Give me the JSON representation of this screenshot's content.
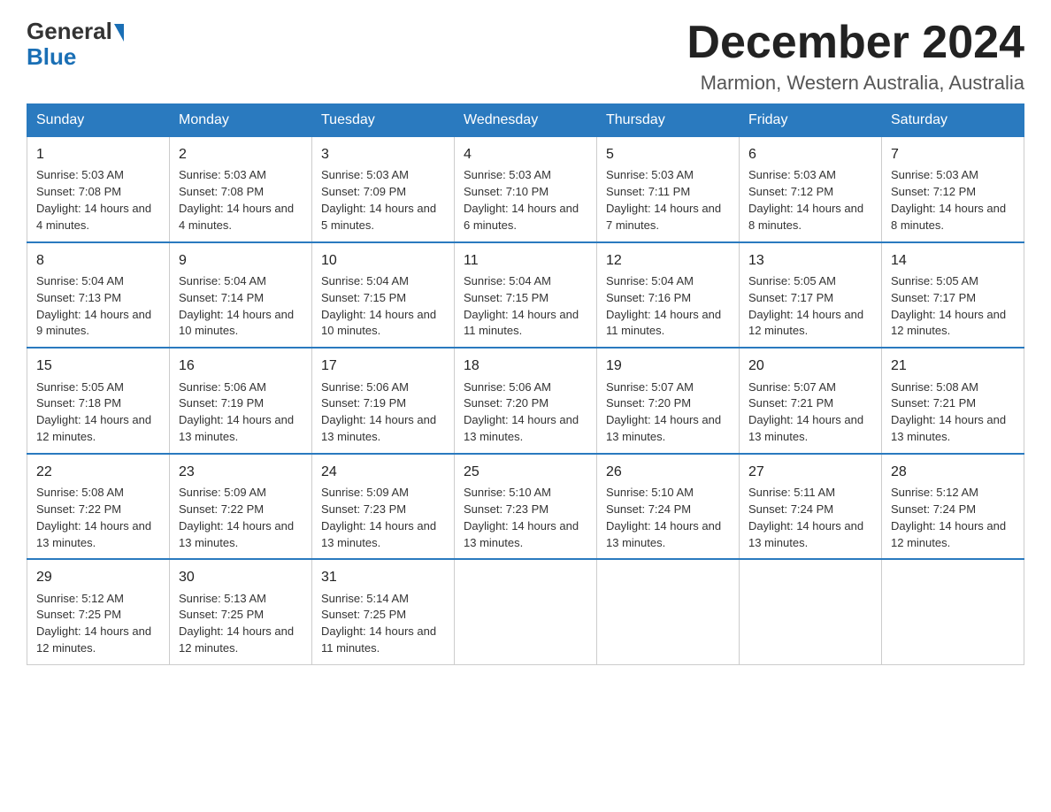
{
  "logo": {
    "text_general": "General",
    "text_blue": "Blue",
    "aria": "GeneralBlue logo"
  },
  "header": {
    "month": "December 2024",
    "location": "Marmion, Western Australia, Australia"
  },
  "days_of_week": [
    "Sunday",
    "Monday",
    "Tuesday",
    "Wednesday",
    "Thursday",
    "Friday",
    "Saturday"
  ],
  "weeks": [
    [
      {
        "day": "1",
        "sunrise": "5:03 AM",
        "sunset": "7:08 PM",
        "daylight": "14 hours and 4 minutes."
      },
      {
        "day": "2",
        "sunrise": "5:03 AM",
        "sunset": "7:08 PM",
        "daylight": "14 hours and 4 minutes."
      },
      {
        "day": "3",
        "sunrise": "5:03 AM",
        "sunset": "7:09 PM",
        "daylight": "14 hours and 5 minutes."
      },
      {
        "day": "4",
        "sunrise": "5:03 AM",
        "sunset": "7:10 PM",
        "daylight": "14 hours and 6 minutes."
      },
      {
        "day": "5",
        "sunrise": "5:03 AM",
        "sunset": "7:11 PM",
        "daylight": "14 hours and 7 minutes."
      },
      {
        "day": "6",
        "sunrise": "5:03 AM",
        "sunset": "7:12 PM",
        "daylight": "14 hours and 8 minutes."
      },
      {
        "day": "7",
        "sunrise": "5:03 AM",
        "sunset": "7:12 PM",
        "daylight": "14 hours and 8 minutes."
      }
    ],
    [
      {
        "day": "8",
        "sunrise": "5:04 AM",
        "sunset": "7:13 PM",
        "daylight": "14 hours and 9 minutes."
      },
      {
        "day": "9",
        "sunrise": "5:04 AM",
        "sunset": "7:14 PM",
        "daylight": "14 hours and 10 minutes."
      },
      {
        "day": "10",
        "sunrise": "5:04 AM",
        "sunset": "7:15 PM",
        "daylight": "14 hours and 10 minutes."
      },
      {
        "day": "11",
        "sunrise": "5:04 AM",
        "sunset": "7:15 PM",
        "daylight": "14 hours and 11 minutes."
      },
      {
        "day": "12",
        "sunrise": "5:04 AM",
        "sunset": "7:16 PM",
        "daylight": "14 hours and 11 minutes."
      },
      {
        "day": "13",
        "sunrise": "5:05 AM",
        "sunset": "7:17 PM",
        "daylight": "14 hours and 12 minutes."
      },
      {
        "day": "14",
        "sunrise": "5:05 AM",
        "sunset": "7:17 PM",
        "daylight": "14 hours and 12 minutes."
      }
    ],
    [
      {
        "day": "15",
        "sunrise": "5:05 AM",
        "sunset": "7:18 PM",
        "daylight": "14 hours and 12 minutes."
      },
      {
        "day": "16",
        "sunrise": "5:06 AM",
        "sunset": "7:19 PM",
        "daylight": "14 hours and 13 minutes."
      },
      {
        "day": "17",
        "sunrise": "5:06 AM",
        "sunset": "7:19 PM",
        "daylight": "14 hours and 13 minutes."
      },
      {
        "day": "18",
        "sunrise": "5:06 AM",
        "sunset": "7:20 PM",
        "daylight": "14 hours and 13 minutes."
      },
      {
        "day": "19",
        "sunrise": "5:07 AM",
        "sunset": "7:20 PM",
        "daylight": "14 hours and 13 minutes."
      },
      {
        "day": "20",
        "sunrise": "5:07 AM",
        "sunset": "7:21 PM",
        "daylight": "14 hours and 13 minutes."
      },
      {
        "day": "21",
        "sunrise": "5:08 AM",
        "sunset": "7:21 PM",
        "daylight": "14 hours and 13 minutes."
      }
    ],
    [
      {
        "day": "22",
        "sunrise": "5:08 AM",
        "sunset": "7:22 PM",
        "daylight": "14 hours and 13 minutes."
      },
      {
        "day": "23",
        "sunrise": "5:09 AM",
        "sunset": "7:22 PM",
        "daylight": "14 hours and 13 minutes."
      },
      {
        "day": "24",
        "sunrise": "5:09 AM",
        "sunset": "7:23 PM",
        "daylight": "14 hours and 13 minutes."
      },
      {
        "day": "25",
        "sunrise": "5:10 AM",
        "sunset": "7:23 PM",
        "daylight": "14 hours and 13 minutes."
      },
      {
        "day": "26",
        "sunrise": "5:10 AM",
        "sunset": "7:24 PM",
        "daylight": "14 hours and 13 minutes."
      },
      {
        "day": "27",
        "sunrise": "5:11 AM",
        "sunset": "7:24 PM",
        "daylight": "14 hours and 13 minutes."
      },
      {
        "day": "28",
        "sunrise": "5:12 AM",
        "sunset": "7:24 PM",
        "daylight": "14 hours and 12 minutes."
      }
    ],
    [
      {
        "day": "29",
        "sunrise": "5:12 AM",
        "sunset": "7:25 PM",
        "daylight": "14 hours and 12 minutes."
      },
      {
        "day": "30",
        "sunrise": "5:13 AM",
        "sunset": "7:25 PM",
        "daylight": "14 hours and 12 minutes."
      },
      {
        "day": "31",
        "sunrise": "5:14 AM",
        "sunset": "7:25 PM",
        "daylight": "14 hours and 11 minutes."
      },
      null,
      null,
      null,
      null
    ]
  ],
  "labels": {
    "sunrise": "Sunrise:",
    "sunset": "Sunset:",
    "daylight": "Daylight:"
  }
}
